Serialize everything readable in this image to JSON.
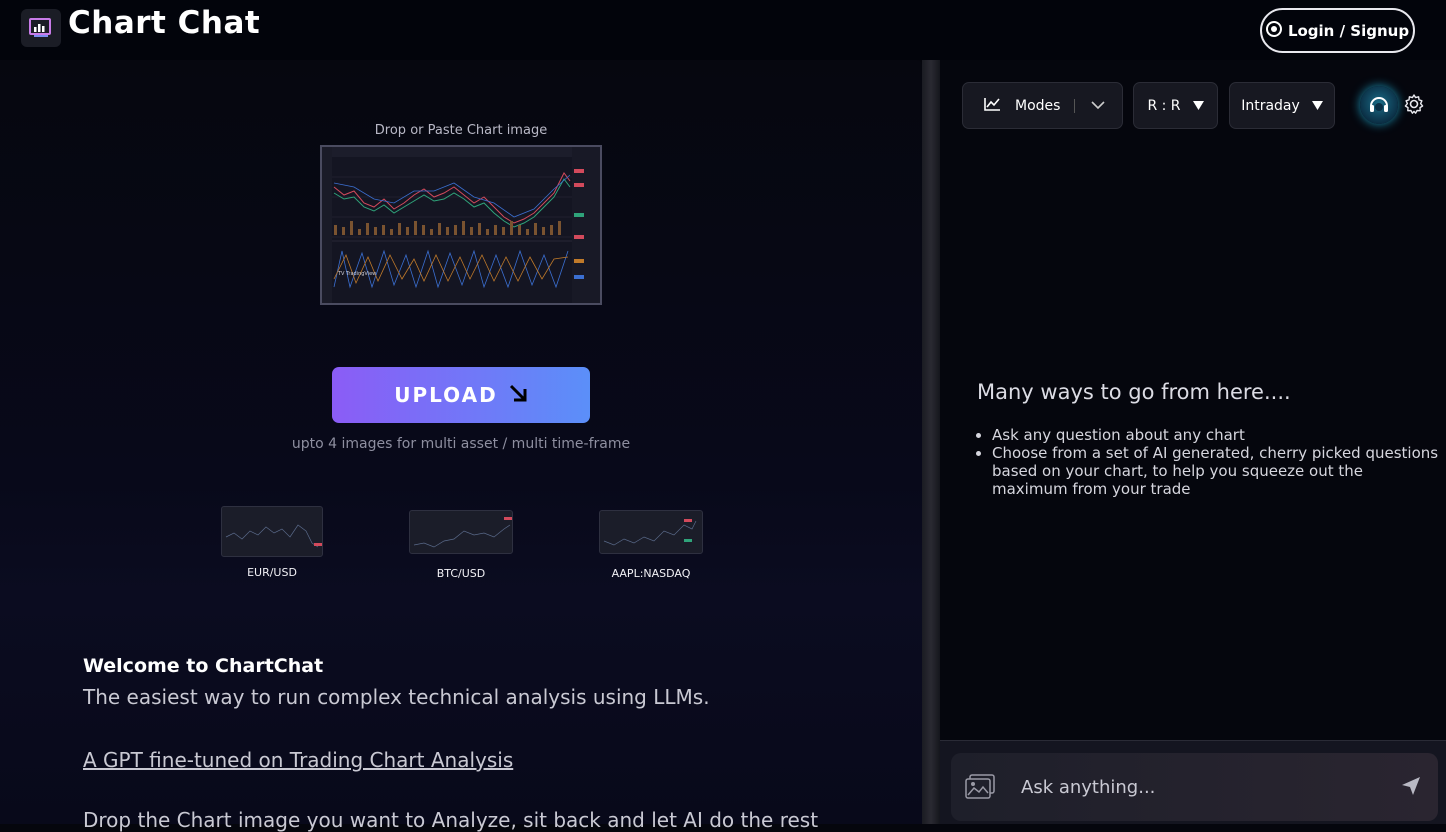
{
  "header": {
    "title": "Chart Chat",
    "login_label": "Login / Signup"
  },
  "upload": {
    "drop_label": "Drop or Paste Chart image",
    "button_label": "UPLOAD",
    "note": "upto 4 images for multi asset / multi time-frame"
  },
  "samples": [
    {
      "label": "EUR/USD"
    },
    {
      "label": "BTC/USD"
    },
    {
      "label": "AAPL:NASDAQ"
    }
  ],
  "welcome": {
    "title": "Welcome to ChartChat",
    "text": "The easiest way to run complex technical analysis using LLMs.",
    "link": "A GPT fine-tuned on Trading Chart Analysis",
    "drop_text": "Drop the Chart image you want to Analyze, sit back and let AI do the rest"
  },
  "controls": {
    "modes_label": "Modes",
    "rr_label": "R : R",
    "timeframe_label": "Intraday"
  },
  "chat": {
    "heading": "Many ways to go from here....",
    "items": [
      "Ask any question about any chart",
      "Choose from a set of AI generated, cherry picked questions based on your chart, to help you squeeze out the maximum from your trade"
    ],
    "placeholder": "Ask anything..."
  },
  "colors": {
    "accent_start": "#8b5cf6",
    "accent_end": "#5b8ff9",
    "background": "#05060d"
  },
  "icons": [
    "logo-icon",
    "google-icon",
    "arrow-down-right-icon",
    "chart-line-icon",
    "chevron-down-icon",
    "caret-down-icon",
    "support-headset-icon",
    "gear-icon",
    "image-upload-icon",
    "send-icon"
  ]
}
